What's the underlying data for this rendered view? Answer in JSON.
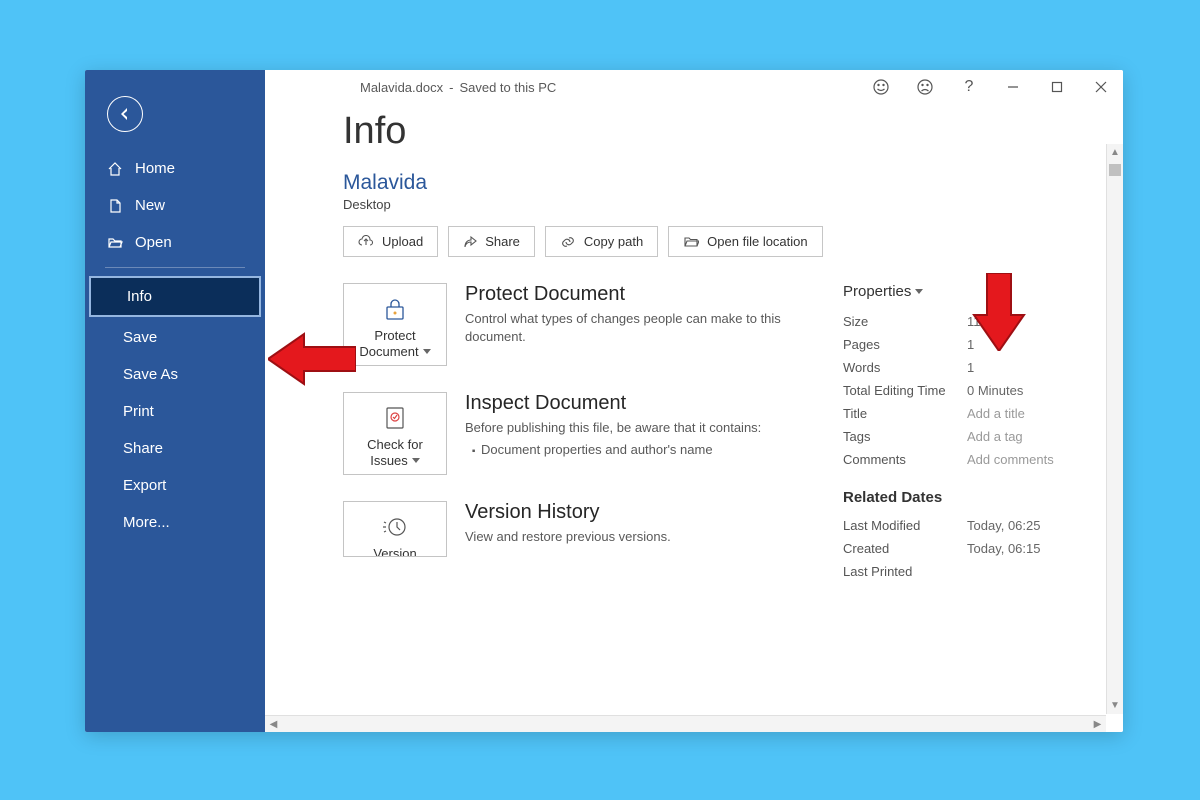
{
  "titlebar": {
    "filename": "Malavida.docx",
    "status": "Saved to this PC"
  },
  "sidebar": {
    "home": "Home",
    "new": "New",
    "open": "Open",
    "info": "Info",
    "save": "Save",
    "saveAs": "Save As",
    "print": "Print",
    "share": "Share",
    "export": "Export",
    "more": "More..."
  },
  "pageTitle": "Info",
  "docName": "Malavida",
  "docLocation": "Desktop",
  "actions": {
    "upload": "Upload",
    "share": "Share",
    "copyPath": "Copy path",
    "openLocation": "Open file location"
  },
  "protect": {
    "btnLine1": "Protect",
    "btnLine2": "Document",
    "title": "Protect Document",
    "desc": "Control what types of changes people can make to this document."
  },
  "inspect": {
    "btnLine1": "Check for",
    "btnLine2": "Issues",
    "title": "Inspect Document",
    "desc": "Before publishing this file, be aware that it contains:",
    "bullet": "Document properties and author's name"
  },
  "version": {
    "btnLine1": "Version",
    "title": "Version History",
    "desc": "View and restore previous versions."
  },
  "propsHead": "Properties",
  "props": {
    "sizeL": "Size",
    "sizeV": "11.6KB",
    "pagesL": "Pages",
    "pagesV": "1",
    "wordsL": "Words",
    "wordsV": "1",
    "editL": "Total Editing Time",
    "editV": "0 Minutes",
    "titleL": "Title",
    "titleV": "Add a title",
    "tagsL": "Tags",
    "tagsV": "Add a tag",
    "commentsL": "Comments",
    "commentsV": "Add comments"
  },
  "relHead": "Related Dates",
  "rel": {
    "modL": "Last Modified",
    "modV": "Today, 06:25",
    "createdL": "Created",
    "createdV": "Today, 06:15",
    "printedL": "Last Printed",
    "printedV": ""
  }
}
